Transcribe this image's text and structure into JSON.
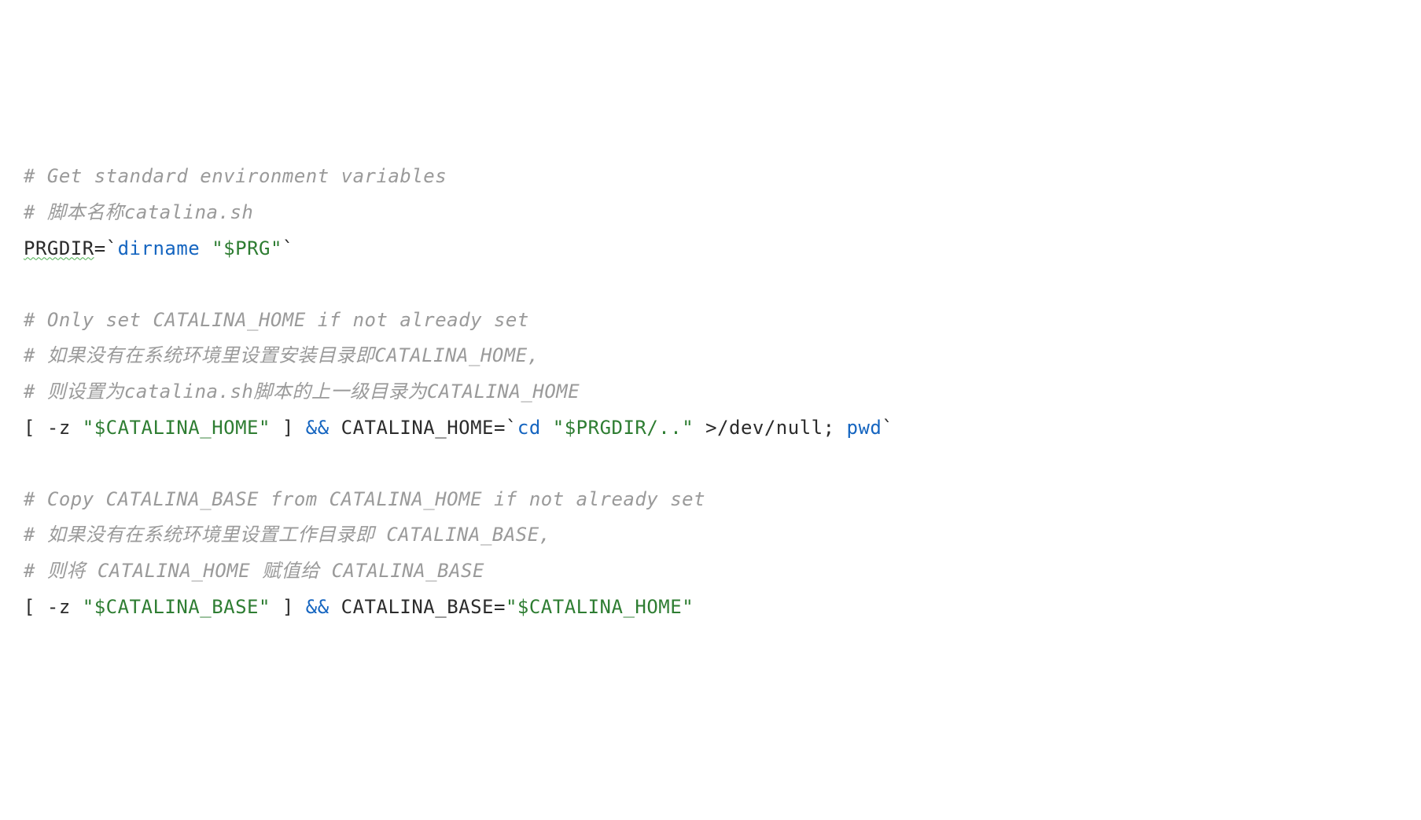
{
  "lines": {
    "l1_comment": "# Get standard environment variables",
    "l2_comment": "# 脚本名称catalina.sh",
    "l3_var": "PRGDIR",
    "l3_eq": "=",
    "l3_bt1": "`",
    "l3_cmd": "dirname",
    "l3_sp": " ",
    "l3_str": "\"$PRG\"",
    "l3_bt2": "`",
    "l5_comment": "# Only set CATALINA_HOME if not already set",
    "l6_comment": "# 如果没有在系统环境里设置安装目录即CATALINA_HOME,",
    "l7_comment": "# 则设置为catalina.sh脚本的上一级目录为CATALINA_HOME",
    "l8_pre": "[ -z ",
    "l8_str1": "\"$CATALINA_HOME\"",
    "l8_mid1": " ] ",
    "l8_op": "&&",
    "l8_mid2": " CATALINA_HOME=",
    "l8_bt1": "`",
    "l8_cd": "cd",
    "l8_sp1": " ",
    "l8_str2": "\"$PRGDIR/..\"",
    "l8_sp2": " >/dev/null; ",
    "l8_pwd": "pwd",
    "l8_bt2": "`",
    "l10_comment": "# Copy CATALINA_BASE from CATALINA_HOME if not already set",
    "l11_comment": "# 如果没有在系统环境里设置工作目录即 CATALINA_BASE,",
    "l12_comment": "# 则将 CATALINA_HOME 赋值给 CATALINA_BASE",
    "l13_pre": "[ -z ",
    "l13_str1": "\"$CATALINA_BASE\"",
    "l13_mid1": " ] ",
    "l13_op": "&&",
    "l13_mid2": " CATALINA_BASE=",
    "l13_str2": "\"$CATALINA_HOME\""
  }
}
